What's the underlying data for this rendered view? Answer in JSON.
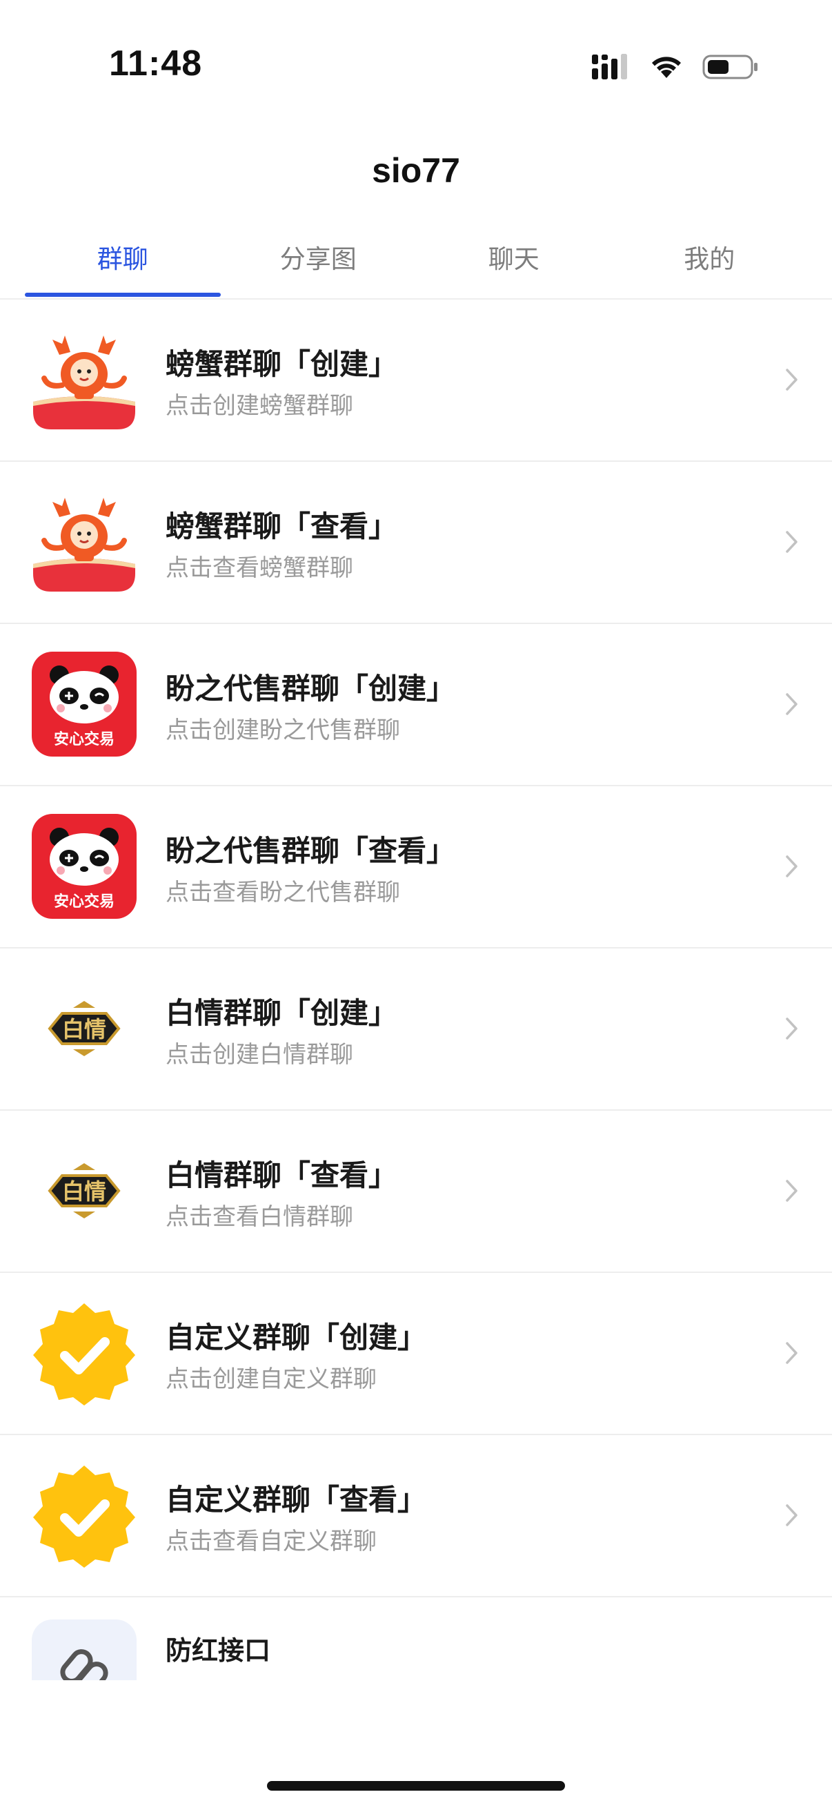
{
  "status_bar": {
    "time": "11:48"
  },
  "header": {
    "title": "sio77"
  },
  "tabs": [
    {
      "label": "群聊",
      "active": true
    },
    {
      "label": "分享图",
      "active": false
    },
    {
      "label": "聊天",
      "active": false
    },
    {
      "label": "我的",
      "active": false
    }
  ],
  "list": {
    "items": [
      {
        "title": "螃蟹群聊「创建」",
        "subtitle": "点击创建螃蟹群聊",
        "icon": "crab-mascot-icon"
      },
      {
        "title": "螃蟹群聊「查看」",
        "subtitle": "点击查看螃蟹群聊",
        "icon": "crab-mascot-icon"
      },
      {
        "title": "盼之代售群聊「创建」",
        "subtitle": "点击创建盼之代售群聊",
        "icon": "panda-logo-icon",
        "icon_text": "安心交易"
      },
      {
        "title": "盼之代售群聊「查看」",
        "subtitle": "点击查看盼之代售群聊",
        "icon": "panda-logo-icon",
        "icon_text": "安心交易"
      },
      {
        "title": "白情群聊「创建」",
        "subtitle": "点击创建白情群聊",
        "icon": "baiqing-logo-icon",
        "icon_text": "白情"
      },
      {
        "title": "白情群聊「查看」",
        "subtitle": "点击查看白情群聊",
        "icon": "baiqing-logo-icon",
        "icon_text": "白情"
      },
      {
        "title": "自定义群聊「创建」",
        "subtitle": "点击创建自定义群聊",
        "icon": "verified-badge-icon"
      },
      {
        "title": "自定义群聊「查看」",
        "subtitle": "点击查看自定义群聊",
        "icon": "verified-badge-icon"
      }
    ],
    "partial_item": {
      "title": "防红接口",
      "icon": "link-icon"
    }
  },
  "colors": {
    "accent": "#2b55e0",
    "title_text": "#1a1a1a",
    "subtitle_text": "#9a9a9a",
    "divider": "#ededed",
    "panda_red": "#e8242f",
    "badge_yellow": "#ffc20e",
    "crab_orange": "#f05a24"
  }
}
